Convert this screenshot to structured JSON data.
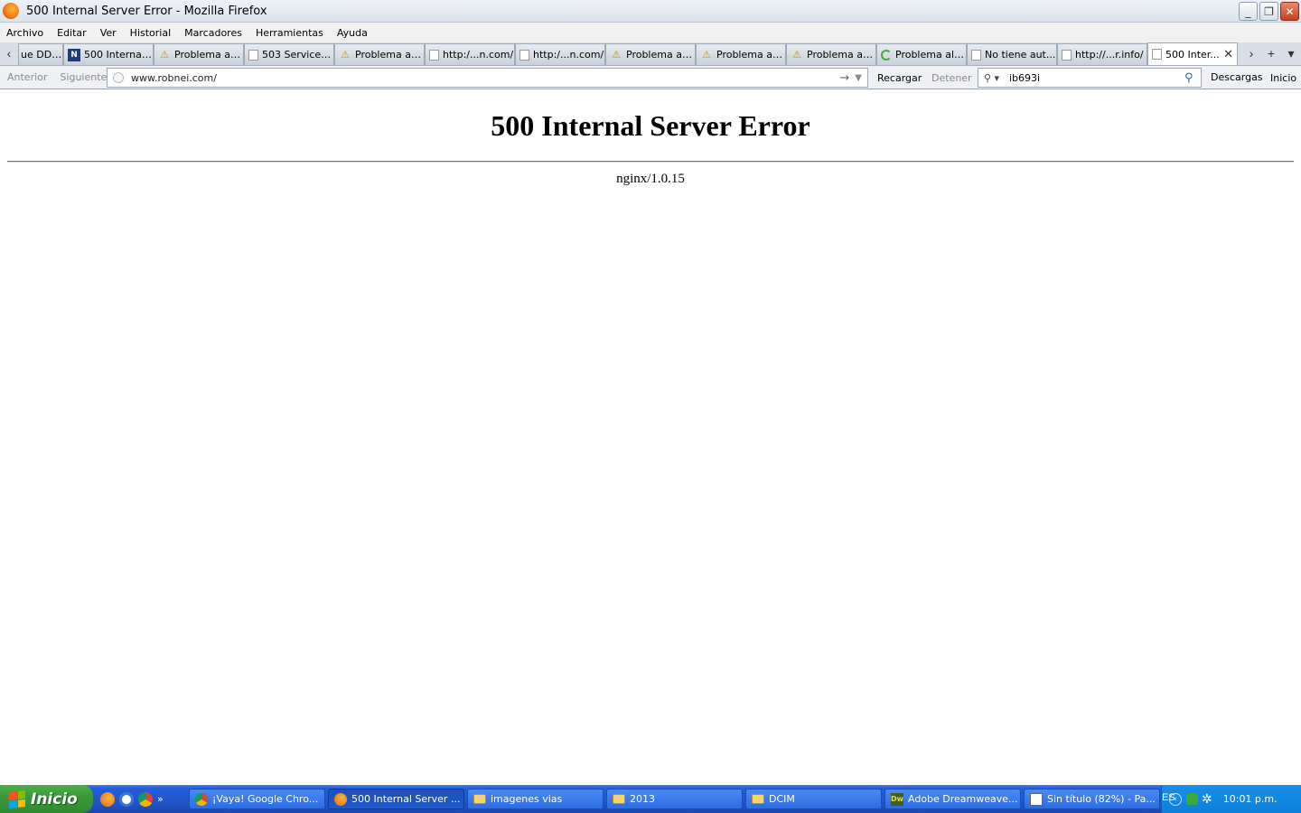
{
  "window": {
    "title": "500 Internal Server Error - Mozilla Firefox",
    "controls": {
      "minimize": "_",
      "restore": "❐",
      "close": "✕"
    }
  },
  "menubar": [
    "Archivo",
    "Editar",
    "Ver",
    "Historial",
    "Marcadores",
    "Herramientas",
    "Ayuda"
  ],
  "tabs": [
    {
      "label": "ue DDO...",
      "icon": "none"
    },
    {
      "label": "500 Internal ...",
      "icon": "site-icon"
    },
    {
      "label": "Problema al c...",
      "icon": "warning-icon"
    },
    {
      "label": "503 Service ...",
      "icon": "blank-page-icon"
    },
    {
      "label": "Problema al c...",
      "icon": "warning-icon"
    },
    {
      "label": "http:/...n.com/",
      "icon": "blank-page-icon"
    },
    {
      "label": "http:/...n.com/",
      "icon": "blank-page-icon"
    },
    {
      "label": "Problema al c...",
      "icon": "warning-icon"
    },
    {
      "label": "Problema al c...",
      "icon": "warning-icon"
    },
    {
      "label": "Problema al c...",
      "icon": "warning-icon"
    },
    {
      "label": "Problema al c...",
      "icon": "loading-icon"
    },
    {
      "label": "No tiene aut...",
      "icon": "blank-page-icon"
    },
    {
      "label": "http://...r.info/",
      "icon": "blank-page-icon"
    },
    {
      "label": "500 Inter...",
      "icon": "blank-page-icon",
      "active": true
    }
  ],
  "tabbar": {
    "scroll_left": "‹",
    "scroll_right": "›",
    "new_tab": "+",
    "list_all": "▾",
    "close": "✕"
  },
  "nav": {
    "back": "Anterior",
    "forward": "Siguiente",
    "url": "www.robnei.com/",
    "go": "→",
    "url_dropdown": "▼",
    "reload": "Recargar",
    "stop": "Detener",
    "search_engine": "⚲ ▾",
    "search_query": "ib693i",
    "search_icon": "⚲",
    "downloads": "Descargas",
    "home": "Inicio"
  },
  "page": {
    "heading": "500 Internal Server Error",
    "server": "nginx/1.0.15"
  },
  "taskbar": {
    "start": "Inicio",
    "quick_more": "»",
    "tasks": [
      {
        "label": "¡Vaya! Google Chro...",
        "icon": "chrome-icon"
      },
      {
        "label": "500 Internal Server ...",
        "icon": "firefox-icon",
        "active": true
      },
      {
        "label": "imagenes vias",
        "icon": "folder-icon"
      },
      {
        "label": "2013",
        "icon": "folder-icon"
      },
      {
        "label": "DCIM",
        "icon": "folder-icon"
      },
      {
        "label": "Adobe Dreamweave...",
        "icon": "dreamweaver-icon"
      },
      {
        "label": "Sin título (82%) - Pa...",
        "icon": "paint-icon"
      }
    ],
    "language": "ES",
    "tray_chevron": "‹",
    "tray_star": "✲",
    "clock": "10:01 p.m."
  }
}
